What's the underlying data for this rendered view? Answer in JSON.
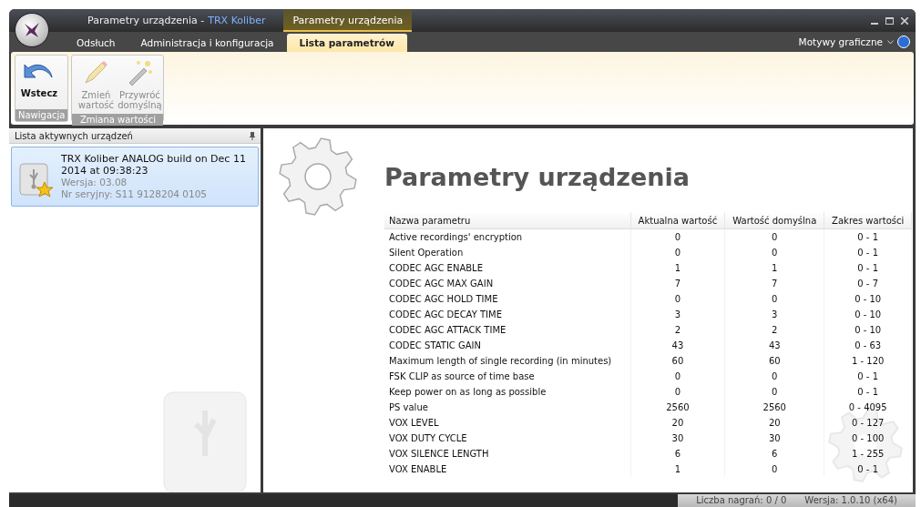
{
  "window": {
    "title": "Parametry urządzenia -",
    "app_name": "TRX Koliber",
    "context_tab": "Parametry urządzenia"
  },
  "tabs": [
    {
      "label": "Odsłuch",
      "selected": false
    },
    {
      "label": "Administracja i konfiguracja",
      "selected": false
    },
    {
      "label": "Lista parametrów",
      "selected": true
    }
  ],
  "themes_menu": "Motywy graficzne",
  "ribbon_groups": [
    {
      "label": "Nawigacja",
      "buttons": [
        {
          "label": "Wstecz",
          "kind": "back",
          "disabled": false
        }
      ]
    },
    {
      "label": "Zmiana wartości",
      "buttons": [
        {
          "label": "Zmień wartość",
          "kind": "pencil",
          "disabled": true
        },
        {
          "label": "Przywróć domyślną",
          "kind": "wand",
          "disabled": true
        }
      ]
    }
  ],
  "devices_panel": {
    "title": "Lista aktywnych urządzeń",
    "devices": [
      {
        "name": "TRX Koliber ANALOG build on Dec 11 2014 at 09:38:23",
        "version": "Wersja: 03.08",
        "serial": "Nr seryjny: S11 9128204 0105",
        "selected": true
      }
    ]
  },
  "main": {
    "heading": "Parametry urządzenia",
    "table": {
      "columns": [
        "Nazwa parametru",
        "Aktualna wartość",
        "Wartość domyślna",
        "Zakres wartości"
      ],
      "rows": [
        [
          "Active recordings' encryption",
          "0",
          "0",
          "0 - 1"
        ],
        [
          "Silent Operation",
          "0",
          "0",
          "0 - 1"
        ],
        [
          "CODEC AGC ENABLE",
          "1",
          "1",
          "0 - 1"
        ],
        [
          "CODEC AGC MAX GAIN",
          "7",
          "7",
          "0 - 7"
        ],
        [
          "CODEC AGC HOLD TIME",
          "0",
          "0",
          "0 - 10"
        ],
        [
          "CODEC AGC DECAY TIME",
          "3",
          "3",
          "0 - 10"
        ],
        [
          "CODEC AGC ATTACK TIME",
          "2",
          "2",
          "0 - 10"
        ],
        [
          "CODEC STATIC GAIN",
          "43",
          "43",
          "0 - 63"
        ],
        [
          "Maximum length of single recording (in minutes)",
          "60",
          "60",
          "1 - 120"
        ],
        [
          "FSK CLIP as source of time base",
          "0",
          "0",
          "0 - 1"
        ],
        [
          "Keep power on as long as possible",
          "0",
          "0",
          "0 - 1"
        ],
        [
          "PS value",
          "2560",
          "2560",
          "0 - 4095"
        ],
        [
          "VOX LEVEL",
          "20",
          "20",
          "0 - 127"
        ],
        [
          "VOX DUTY CYCLE",
          "30",
          "30",
          "0 - 100"
        ],
        [
          "VOX SILENCE LENGTH",
          "6",
          "6",
          "1 - 255"
        ],
        [
          "VOX ENABLE",
          "1",
          "0",
          "0 - 1"
        ]
      ]
    }
  },
  "status_bar": [
    "Liczba nagrań: 0 / 0",
    "Wersja: 1.0.10 (x64)"
  ]
}
